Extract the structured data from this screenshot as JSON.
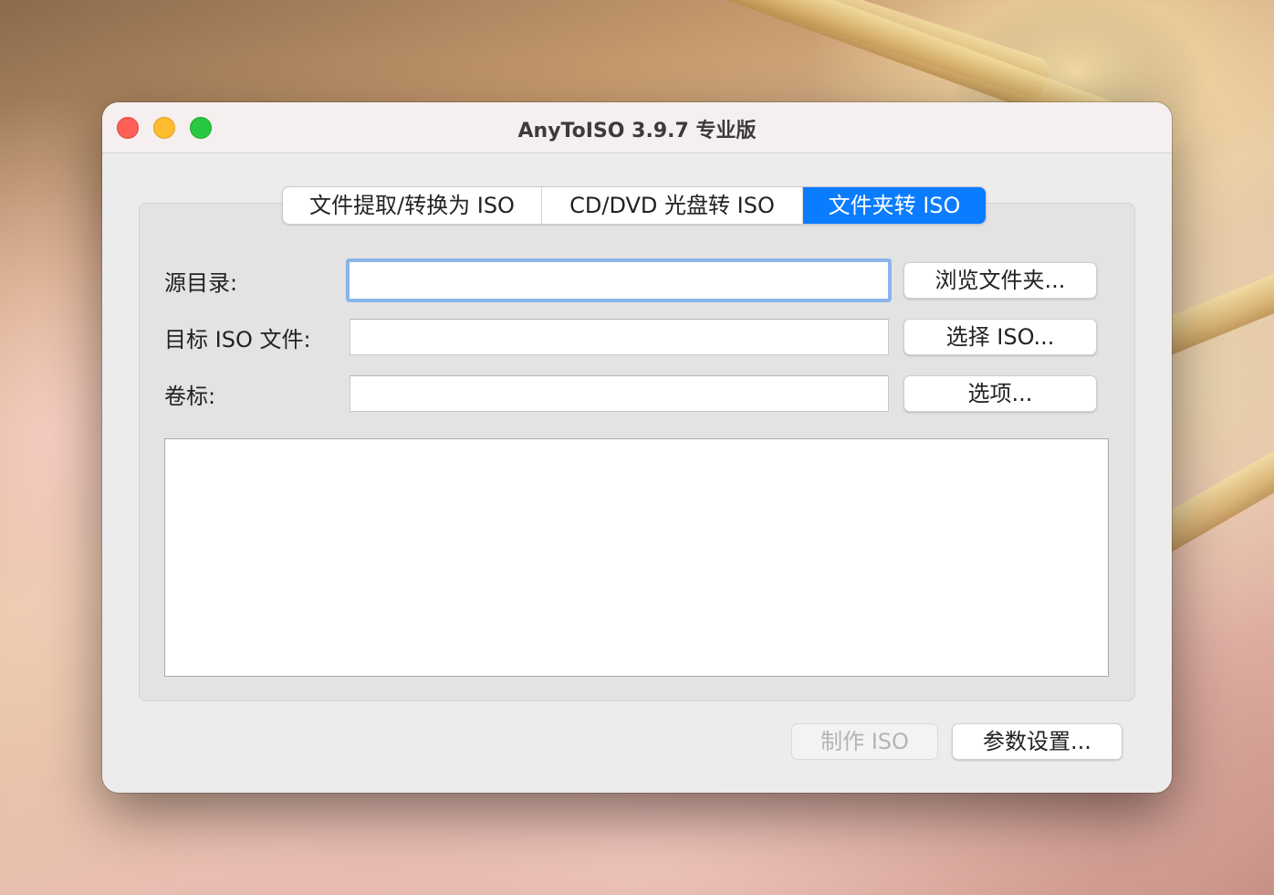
{
  "window": {
    "title": "AnyToISO 3.9.7 专业版"
  },
  "tabs": [
    {
      "label": "文件提取/转换为 ISO",
      "active": false
    },
    {
      "label": "CD/DVD 光盘转 ISO",
      "active": false
    },
    {
      "label": "文件夹转 ISO",
      "active": true
    }
  ],
  "form": {
    "source": {
      "label": "源目录:",
      "value": "",
      "button": "浏览文件夹..."
    },
    "target": {
      "label": "目标 ISO 文件:",
      "value": "",
      "button": "选择 ISO..."
    },
    "volume": {
      "label": "卷标:",
      "value": "",
      "button": "选项..."
    }
  },
  "log": {
    "text": ""
  },
  "actions": {
    "make_iso": "制作 ISO",
    "settings": "参数设置..."
  },
  "colors": {
    "accent": "#0a7cff",
    "close": "#fe5f57",
    "minimize": "#febc2e",
    "zoom": "#28c840",
    "focus_ring": "#8ab4ea"
  }
}
